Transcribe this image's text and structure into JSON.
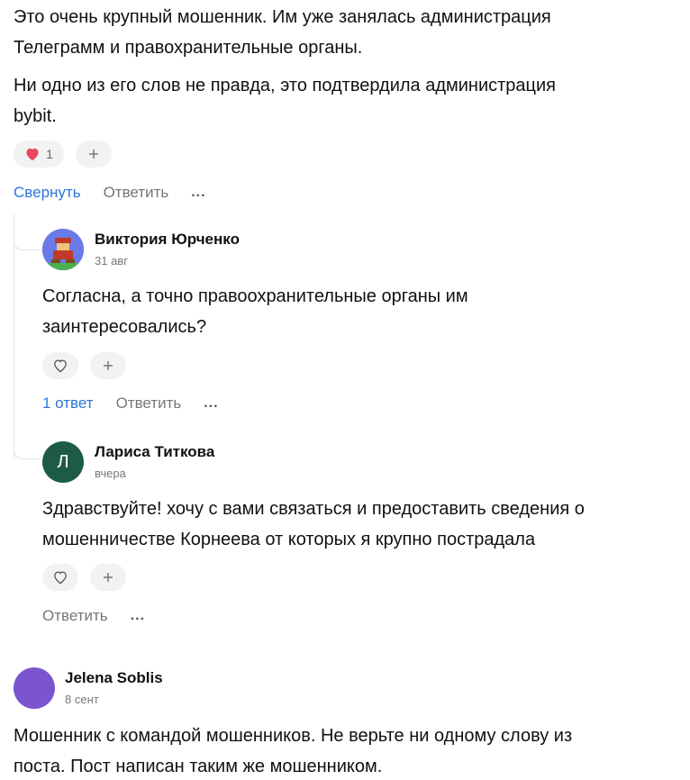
{
  "comment_top": {
    "paragraph1": [
      "Это очень крупный мошенник. Им уже занялась администрация",
      "Телеграмм и правохранительные органы."
    ],
    "paragraph2": [
      "Ни одно из его слов не правда, это подтвердила администрация",
      "bybit."
    ],
    "likes_count": "1",
    "actions": {
      "collapse": "Свернуть",
      "reply": "Ответить",
      "more": "..."
    }
  },
  "reply1": {
    "author": "Виктория Юрченко",
    "date": "31 авг",
    "lines": [
      "Согласна, а точно правоохранительные органы им",
      "заинтересовались?"
    ],
    "actions": {
      "replies": "1 ответ",
      "reply": "Ответить",
      "more": "..."
    }
  },
  "reply2": {
    "author": "Лариса Титкова",
    "avatar_letter": "Л",
    "avatar_color": "#1d5b46",
    "date": "вчера",
    "lines": [
      "Здравствуйте! хочу с вами связаться и предоставить сведения о",
      "мошенничестве Корнеева от которых я крупно пострадала"
    ],
    "actions": {
      "reply": "Ответить",
      "more": "..."
    }
  },
  "comment_bottom": {
    "author": "Jelena Soblis",
    "avatar_color": "#7a55cf",
    "date": "8 сент",
    "lines": [
      "Мошенник с командой мошенников. Не верьте ни одному слову из",
      "поста. Пост написан таким же мошенником."
    ]
  },
  "icons": {
    "heart_filled": "heart-filled-icon",
    "heart_outline": "heart-outline-icon",
    "plus": "plus-icon"
  },
  "colors": {
    "accent_link": "#2e74d6",
    "heart": "#e8455e"
  }
}
